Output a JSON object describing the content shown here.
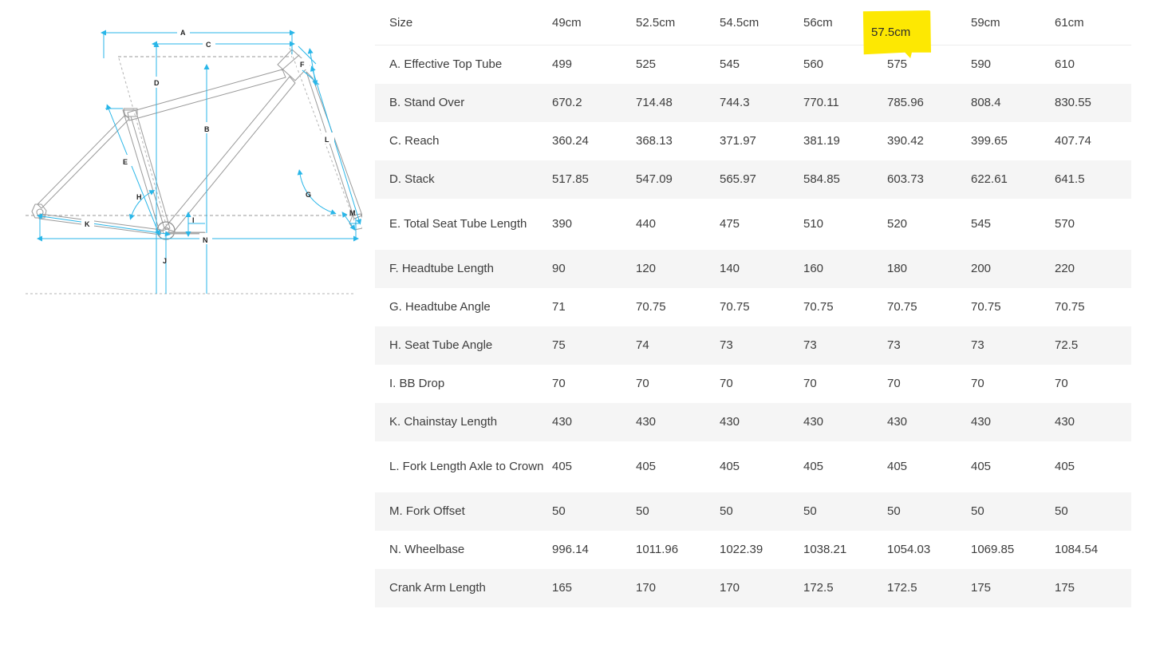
{
  "diagram": {
    "title": "bike-frame-geometry-diagram",
    "accent_color": "#29b6e8",
    "frame_color": "#9a9a9a",
    "labels": [
      {
        "key": "A",
        "text": "A"
      },
      {
        "key": "B",
        "text": "B"
      },
      {
        "key": "C",
        "text": "C"
      },
      {
        "key": "D",
        "text": "D"
      },
      {
        "key": "E",
        "text": "E"
      },
      {
        "key": "F",
        "text": "F"
      },
      {
        "key": "G",
        "text": "G"
      },
      {
        "key": "H",
        "text": "H"
      },
      {
        "key": "I",
        "text": "I"
      },
      {
        "key": "J",
        "text": "J"
      },
      {
        "key": "K",
        "text": "K"
      },
      {
        "key": "L",
        "text": "L"
      },
      {
        "key": "M",
        "text": "M"
      },
      {
        "key": "N",
        "text": "N"
      }
    ]
  },
  "highlight": {
    "color": "#fde802",
    "size_label": "57.5cm",
    "column_index": 5
  },
  "chart_data": {
    "type": "table",
    "title": "Bike Frame Geometry Specification",
    "columns": [
      "Size",
      "49cm",
      "52.5cm",
      "54.5cm",
      "56cm",
      "57.5cm",
      "59cm",
      "61cm"
    ],
    "rows": [
      {
        "label": "A. Effective Top Tube",
        "values": [
          "499",
          "525",
          "545",
          "560",
          "575",
          "590",
          "610"
        ],
        "tall": false
      },
      {
        "label": "B. Stand Over",
        "values": [
          "670.2",
          "714.48",
          "744.3",
          "770.11",
          "785.96",
          "808.4",
          "830.55"
        ],
        "tall": false
      },
      {
        "label": "C. Reach",
        "values": [
          "360.24",
          "368.13",
          "371.97",
          "381.19",
          "390.42",
          "399.65",
          "407.74"
        ],
        "tall": false
      },
      {
        "label": "D. Stack",
        "values": [
          "517.85",
          "547.09",
          "565.97",
          "584.85",
          "603.73",
          "622.61",
          "641.5"
        ],
        "tall": false
      },
      {
        "label": "E. Total Seat Tube Length",
        "values": [
          "390",
          "440",
          "475",
          "510",
          "520",
          "545",
          "570"
        ],
        "tall": true
      },
      {
        "label": "F. Headtube Length",
        "values": [
          "90",
          "120",
          "140",
          "160",
          "180",
          "200",
          "220"
        ],
        "tall": false
      },
      {
        "label": "G. Headtube Angle",
        "values": [
          "71",
          "70.75",
          "70.75",
          "70.75",
          "70.75",
          "70.75",
          "70.75"
        ],
        "tall": false
      },
      {
        "label": "H. Seat Tube Angle",
        "values": [
          "75",
          "74",
          "73",
          "73",
          "73",
          "73",
          "72.5"
        ],
        "tall": false
      },
      {
        "label": "I. BB Drop",
        "values": [
          "70",
          "70",
          "70",
          "70",
          "70",
          "70",
          "70"
        ],
        "tall": false
      },
      {
        "label": "K. Chainstay Length",
        "values": [
          "430",
          "430",
          "430",
          "430",
          "430",
          "430",
          "430"
        ],
        "tall": false
      },
      {
        "label": "L. Fork Length Axle to Crown",
        "values": [
          "405",
          "405",
          "405",
          "405",
          "405",
          "405",
          "405"
        ],
        "tall": true
      },
      {
        "label": "M. Fork Offset",
        "values": [
          "50",
          "50",
          "50",
          "50",
          "50",
          "50",
          "50"
        ],
        "tall": false
      },
      {
        "label": "N. Wheelbase",
        "values": [
          "996.14",
          "1011.96",
          "1022.39",
          "1038.21",
          "1054.03",
          "1069.85",
          "1084.54"
        ],
        "tall": false
      },
      {
        "label": "Crank Arm Length",
        "values": [
          "165",
          "170",
          "170",
          "172.5",
          "172.5",
          "175",
          "175"
        ],
        "tall": false
      }
    ]
  }
}
